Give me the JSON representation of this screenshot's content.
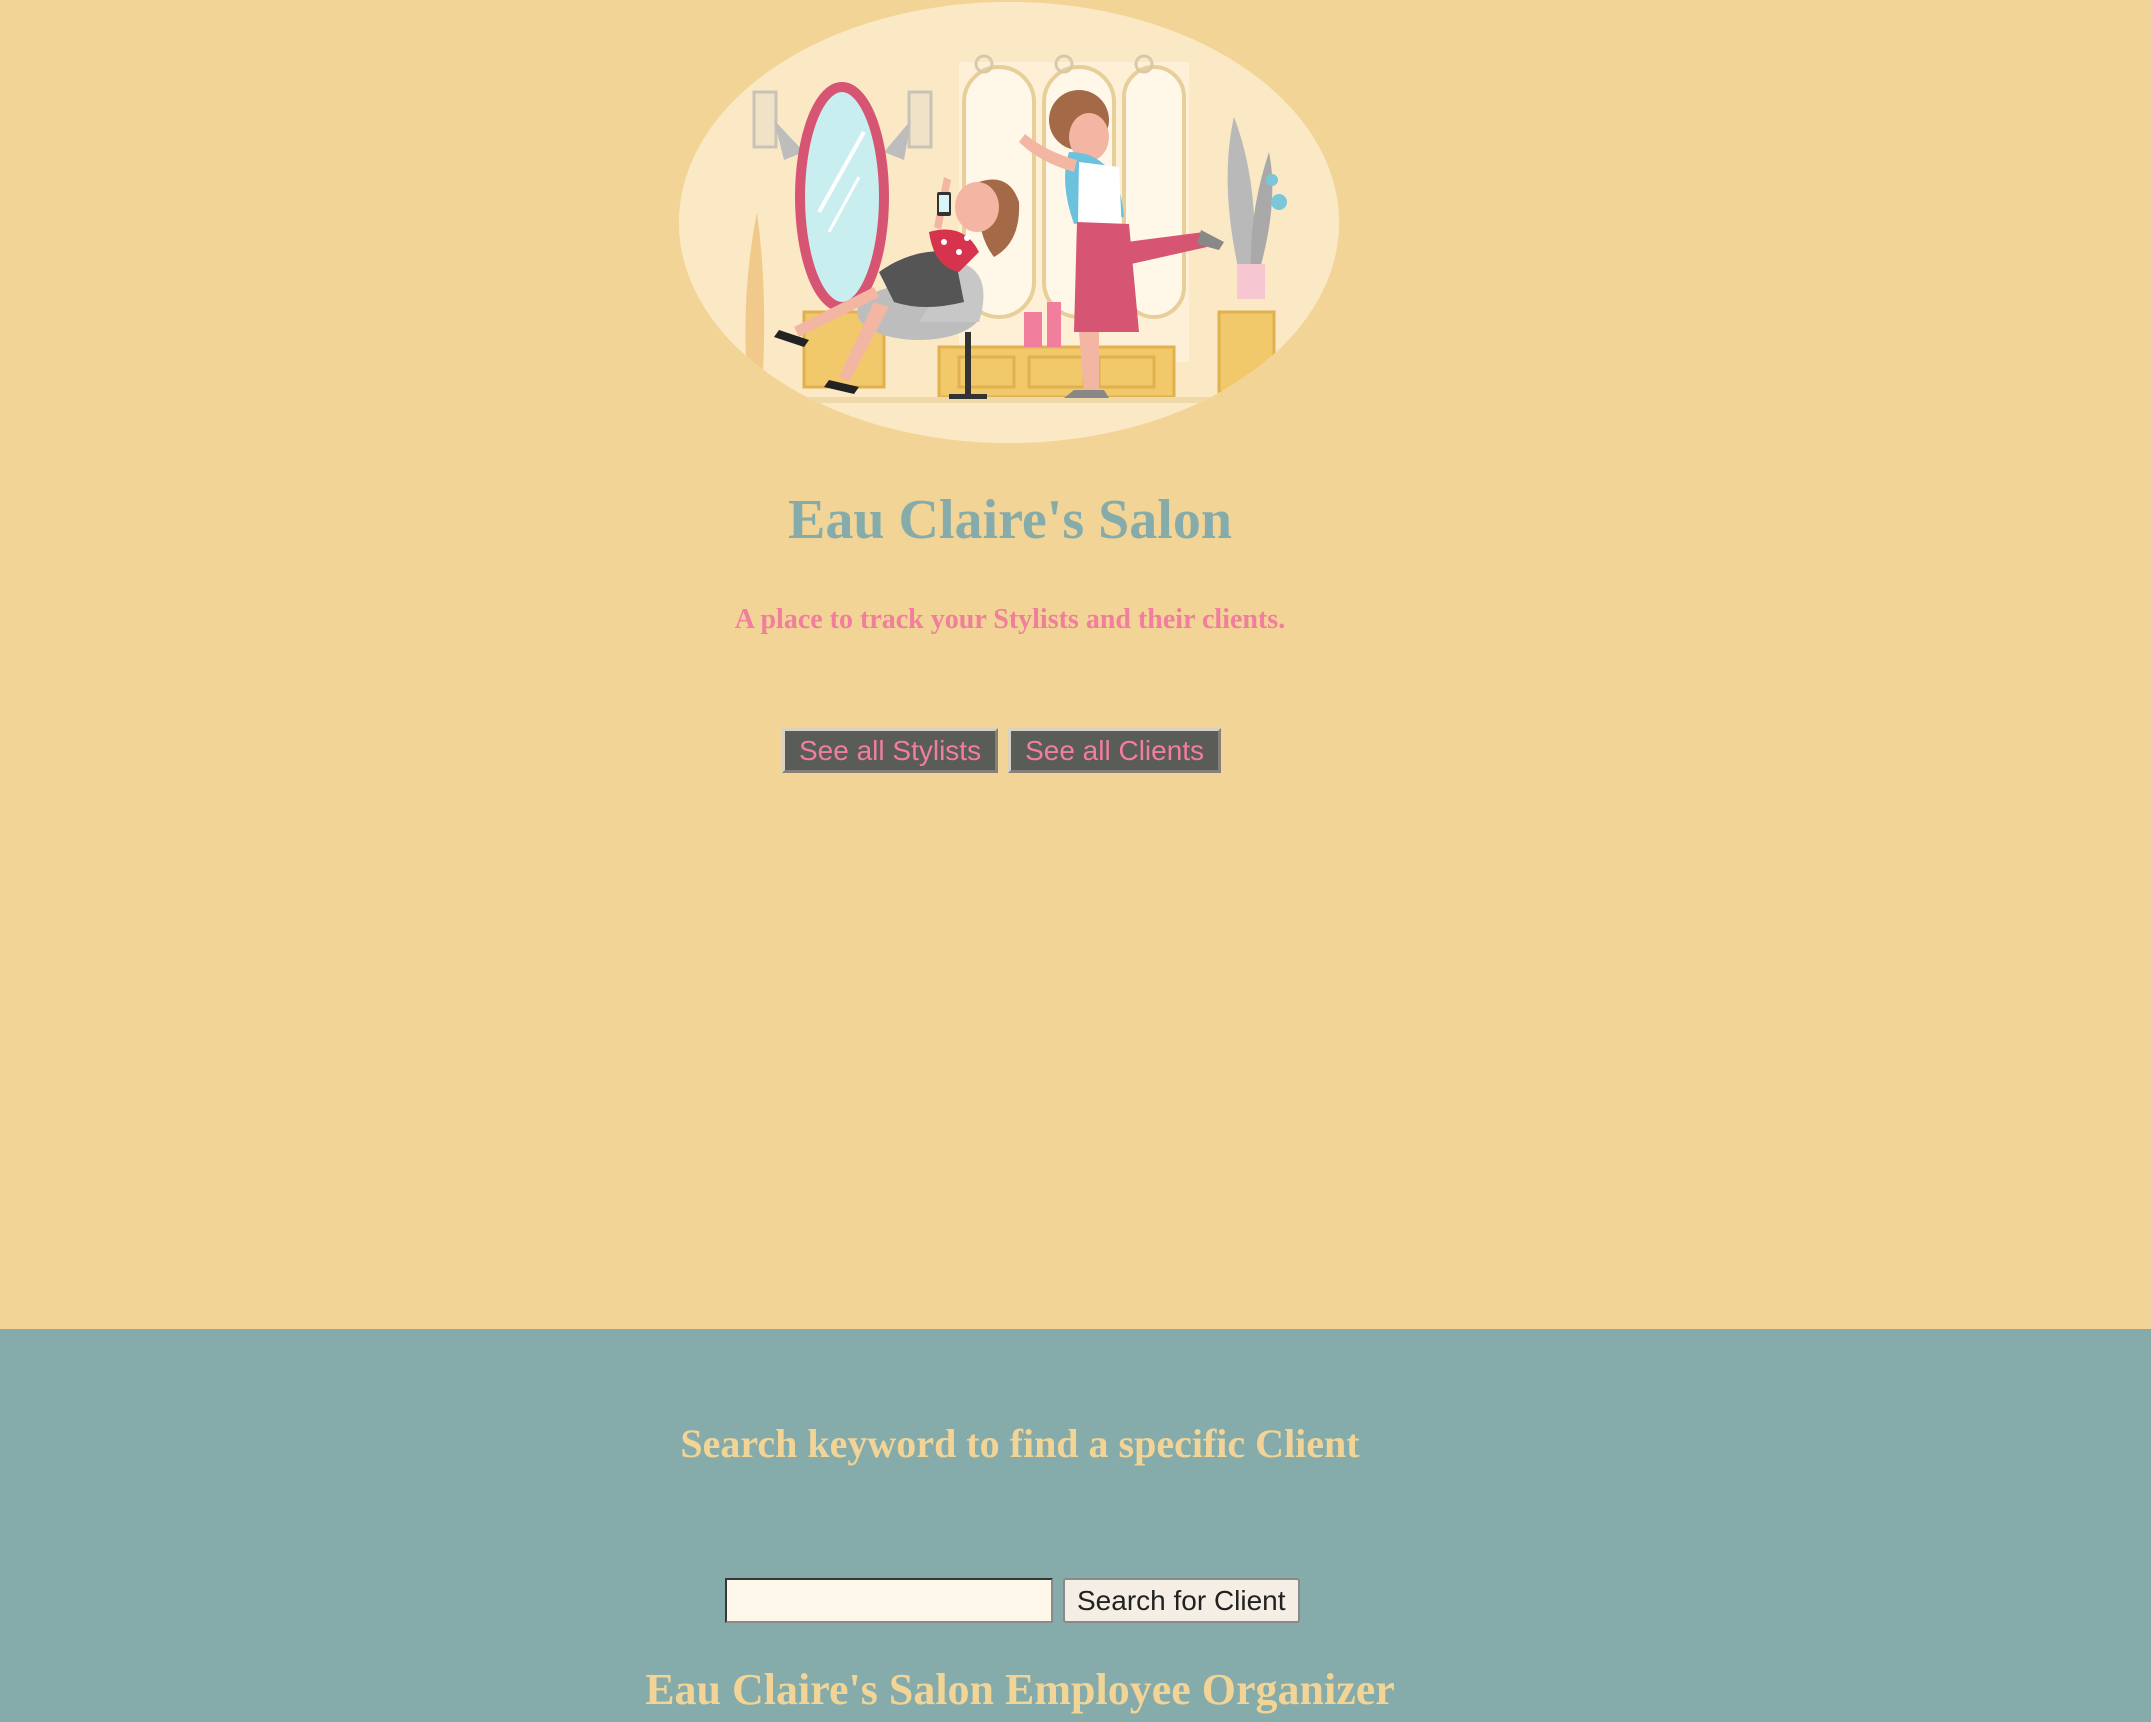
{
  "hero": {
    "image_name": "salon-illustration"
  },
  "header": {
    "title": "Eau Claire's Salon",
    "subtitle": "A place to track your Stylists and their clients."
  },
  "nav": {
    "stylists_button": "See all Stylists",
    "clients_button": "See all Clients"
  },
  "search": {
    "heading": "Search keyword to find a specific Client",
    "input_value": "",
    "input_placeholder": "",
    "button_label": "Search for Client"
  },
  "footer": {
    "title": "Eau Claire's Salon Employee Organizer"
  },
  "colors": {
    "page_background": "#f2d596",
    "section_background": "#85abab",
    "accent_pink": "#f07e9c",
    "button_dark": "#5a5c58"
  }
}
